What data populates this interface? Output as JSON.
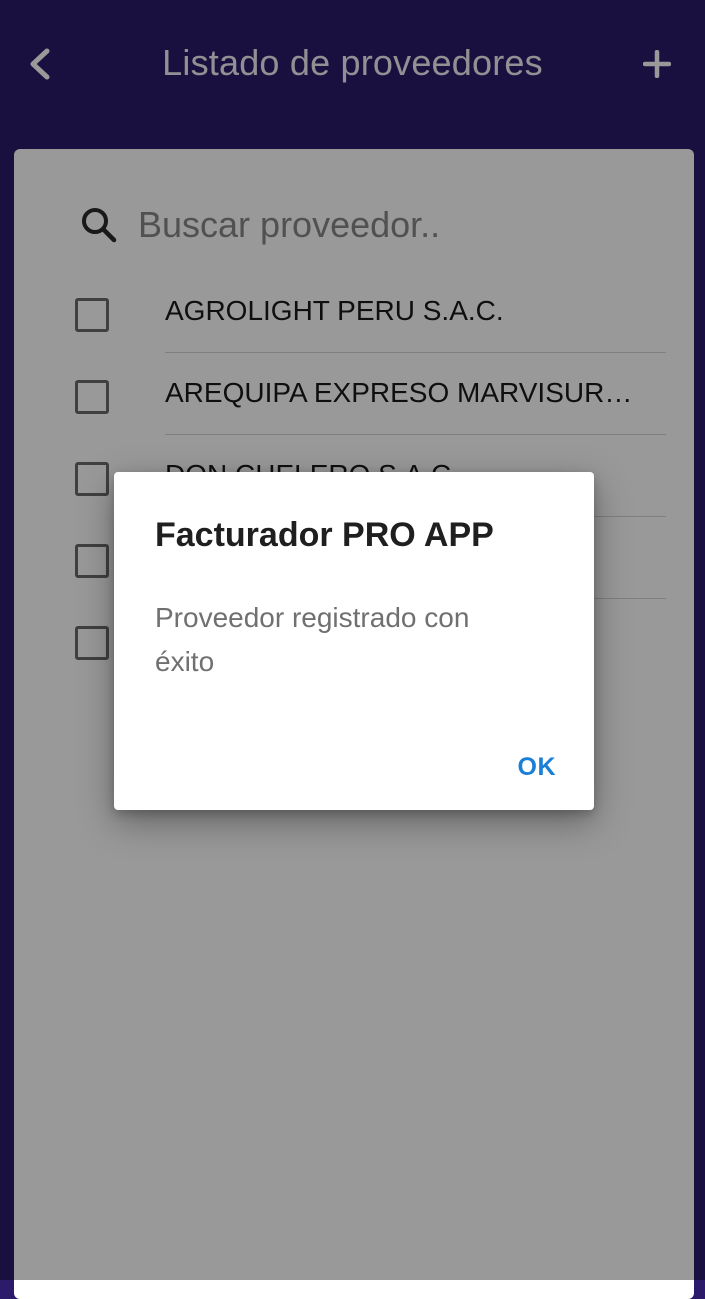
{
  "header": {
    "title": "Listado de proveedores",
    "back_icon": "chevron-left-icon",
    "add_icon": "plus-icon"
  },
  "search": {
    "placeholder": "Buscar proveedor..",
    "icon": "search-icon"
  },
  "suppliers": [
    {
      "name": "AGROLIGHT PERU S.A.C.",
      "checked": false
    },
    {
      "name": "AREQUIPA EXPRESO MARVISUR …",
      "checked": false
    },
    {
      "name": "DON CHELERO S.A.C.",
      "checked": false
    },
    {
      "name": "",
      "checked": false
    },
    {
      "name": "",
      "checked": false
    }
  ],
  "dialog": {
    "title": "Facturador PRO APP",
    "message": "Proveedor registrado con éxito",
    "ok_label": "OK"
  },
  "colors": {
    "header_bg": "#2c1b6a",
    "accent": "#1a7fd6",
    "scrim": "rgba(0,0,0,0.40)"
  }
}
